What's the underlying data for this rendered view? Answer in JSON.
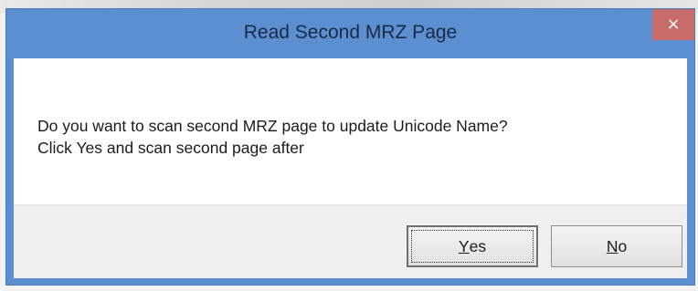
{
  "dialog": {
    "title": "Read Second MRZ Page",
    "close_glyph": "×",
    "message_line1": "Do you want to scan second MRZ page to update Unicode Name?",
    "message_line2": "Click Yes and scan second page after",
    "buttons": {
      "yes": {
        "mnemonic": "Y",
        "rest": "es"
      },
      "no": {
        "mnemonic": "N",
        "rest": "o"
      }
    }
  },
  "colors": {
    "title_bar": "#5b8fd2",
    "close_button": "#c76b6b",
    "client_bg": "#ffffff",
    "footer_bg": "#f0f0f0"
  },
  "icons": {
    "close": "close-icon"
  }
}
